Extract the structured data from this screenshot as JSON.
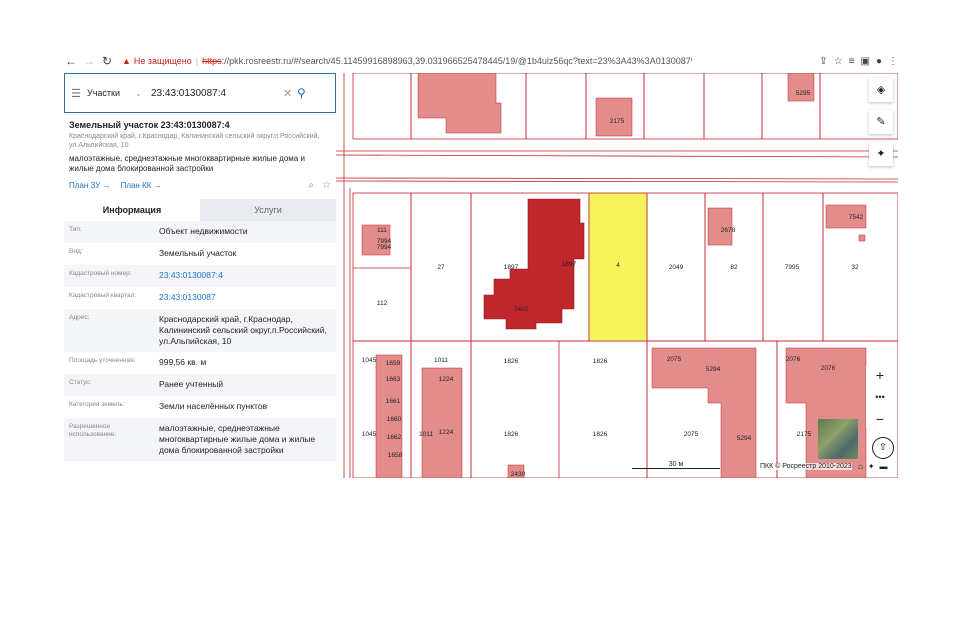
{
  "browser": {
    "warning": "Не защищено",
    "url_scheme": "https",
    "url_rest": "://pkk.rosreestr.ru/#/search/45.11459916898963,39.031966525478445/19/@1b4ulz56qc?text=23%3A43%3A0130087%3A4&type=1&opene..."
  },
  "search": {
    "layer": "Участки",
    "query": "23:43:0130087:4"
  },
  "parcel": {
    "title": "Земельный участок 23:43:0130087:4",
    "address_small": "Краснодарский край, г.Краснодар, Калининский сельский округ,п.Российский, ул.Альпийская, 10",
    "use": "малоэтажные, среднеэтажные многоквартирные жилые дома и жилые дома блокированной застройки",
    "link1": "План ЗУ →",
    "link2": "План КК →"
  },
  "tabs": [
    "Информация",
    "Услуги"
  ],
  "info_rows": [
    {
      "label": "Тип:",
      "value": "Объект недвижимости"
    },
    {
      "label": "Вид:",
      "value": "Земельный участок"
    },
    {
      "label": "Кадастровый номер:",
      "value": "23:43:0130087:4"
    },
    {
      "label": "Кадастровый квартал:",
      "value": "23:43:0130087"
    },
    {
      "label": "Адрес:",
      "value": "Краснодарский край, г.Краснодар, Калининский сельский округ,п.Российский, ул.Альпийская, 10"
    },
    {
      "label": "Площадь уточненная:",
      "value": "999,56 кв. м"
    },
    {
      "label": "Статус:",
      "value": "Ранее учтенный"
    },
    {
      "label": "Категория земель:",
      "value": "Земли населённых пунктов"
    },
    {
      "label": "Разрешенное использование:",
      "value": "малоэтажные, среднеэтажные многоквартирные жилые дома и жилые дома блокированной застройки"
    }
  ],
  "map": {
    "labels": [
      "111",
      "7994",
      "7994",
      "112",
      "27",
      "1897",
      "1897",
      "7402",
      "4",
      "2049",
      "82",
      "7995",
      "32",
      "2678",
      "7542",
      "5295",
      "2175",
      "1045",
      "1659",
      "1663",
      "1661",
      "1660",
      "1662",
      "1658",
      "1011",
      "1224",
      "1224",
      "1011",
      "1826",
      "1826",
      "1826",
      "1826",
      "2075",
      "5294",
      "2075",
      "5294",
      "2076",
      "2076",
      "2175",
      "1045",
      "2430"
    ],
    "scale": "30 м",
    "copyright": "ПКК © Росреестр 2010-2023"
  },
  "colors": {
    "parcel_pink": "#e28c8c",
    "parcel_red": "#c0272d",
    "selected_yellow": "#f7f35a",
    "accent": "#1a73c8"
  }
}
